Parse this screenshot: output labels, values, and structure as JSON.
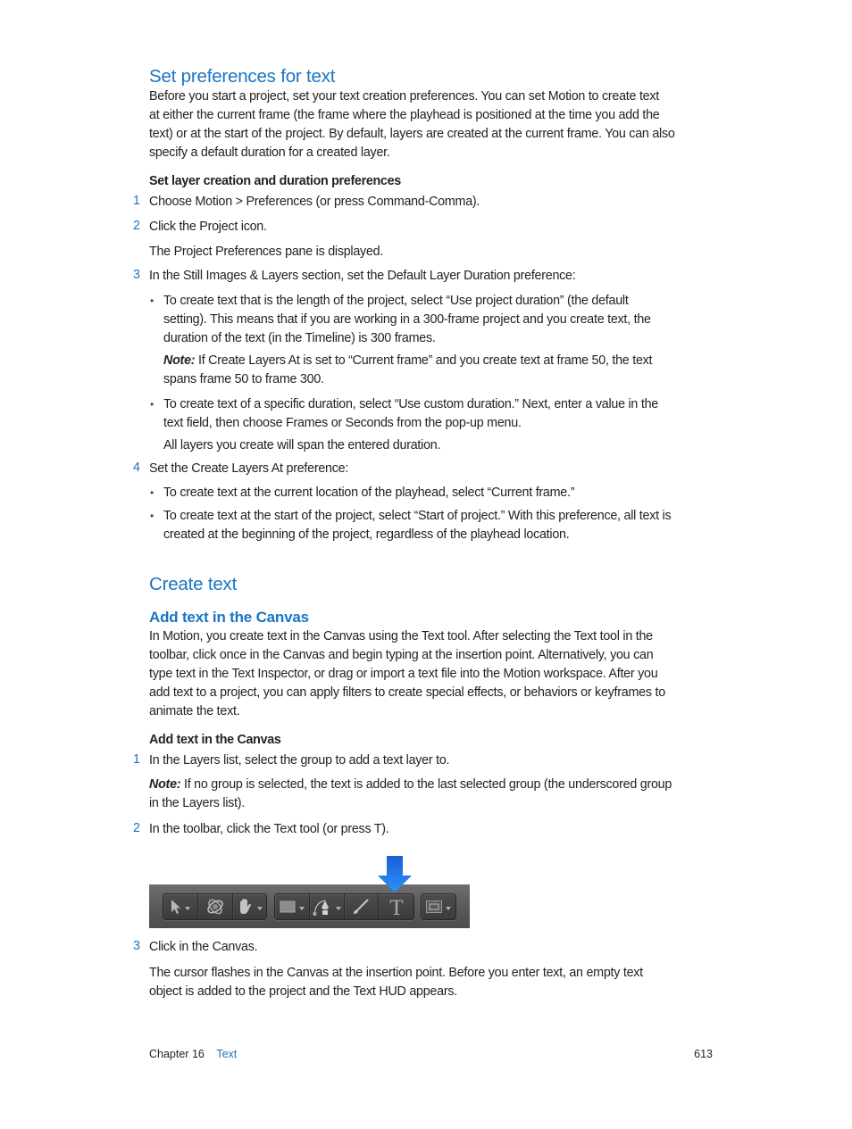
{
  "section1": {
    "heading": "Set preferences for text",
    "intro_lines": [
      "Before you start a project, set your text creation preferences. You can set Motion to create text",
      "at either the current frame (the frame where the playhead is positioned at the time you add the",
      "text) or at the start of the project. By default, layers are created at the current frame. You can also",
      "specify a default duration for a created layer."
    ],
    "task_title": "Set layer creation and duration preferences",
    "steps": [
      {
        "num": "1",
        "text": "Choose Motion > Preferences (or press Command-Comma)."
      },
      {
        "num": "2",
        "text": "Click the Project icon.",
        "result": "The Project Preferences pane is displayed."
      },
      {
        "num": "3",
        "text": "In the Still Images & Layers section, set the Default Layer Duration preference:",
        "bullets": [
          {
            "lines": [
              "To create text that is the length of the project, select “Use project duration” (the default",
              "setting). This means that if you are working in a 300-frame project and you create text, the",
              "duration of the text (in the Timeline) is 300 frames."
            ],
            "note_label": "Note:",
            "note_lines": [
              " If Create Layers At is set to “Current frame” and you create text at frame 50, the text",
              "spans frame 50 to frame 300."
            ]
          },
          {
            "lines": [
              "To create text of a specific duration, select “Use custom duration.” Next, enter a value in the",
              "text field, then choose Frames or Seconds from the pop-up menu."
            ],
            "result": "All layers you create will span the entered duration."
          }
        ]
      },
      {
        "num": "4",
        "text": "Set the Create Layers At preference:",
        "bullets": [
          {
            "lines": [
              "To create text at the current location of the playhead, select “Current frame.”"
            ]
          },
          {
            "lines": [
              "To create text at the start of the project, select “Start of project.” With this preference, all text is",
              "created at the beginning of the project, regardless of the playhead location."
            ]
          }
        ]
      }
    ]
  },
  "section2": {
    "heading": "Create text",
    "subheading": "Add text in the Canvas",
    "intro_lines": [
      "In Motion, you create text in the Canvas using the Text tool. After selecting the Text tool in the",
      "toolbar, click once in the Canvas and begin typing at the insertion point. Alternatively, you can",
      "type text in the Text Inspector, or drag or import a text file into the Motion workspace. After you",
      "add text to a project, you can apply filters to create special effects, or behaviors or keyframes to",
      "animate the text."
    ],
    "task_title": "Add text in the Canvas",
    "steps": [
      {
        "num": "1",
        "text": "In the Layers list, select the group to add a text layer to.",
        "note_label": "Note:",
        "note_lines": [
          " If no group is selected, the text is added to the last selected group (the underscored group",
          "in the Layers list)."
        ]
      },
      {
        "num": "2",
        "text": "In the toolbar, click the Text tool (or press T)."
      },
      {
        "num": "3",
        "text": "Click in the Canvas.",
        "result_lines": [
          "The cursor flashes in the Canvas at the insertion point. Before you enter text, an empty text",
          "object is added to the project and the Text HUD appears."
        ]
      }
    ]
  },
  "toolbar_figure": {
    "groups": [
      {
        "tools": [
          {
            "icon": "select-arrow-icon",
            "has_menu": true
          },
          {
            "icon": "3d-transform-icon",
            "has_menu": false
          },
          {
            "icon": "pan-hand-icon",
            "has_menu": true
          }
        ]
      },
      {
        "tools": [
          {
            "icon": "rectangle-shape-icon",
            "has_menu": true
          },
          {
            "icon": "bezier-pen-icon",
            "has_menu": true
          },
          {
            "icon": "paint-brush-icon",
            "has_menu": false
          },
          {
            "icon": "text-tool-icon",
            "label": "T",
            "has_menu": false,
            "highlighted": true
          }
        ]
      },
      {
        "tools": [
          {
            "icon": "mask-rectangle-icon",
            "has_menu": true
          }
        ]
      }
    ],
    "callout_color": "#1f7cf0"
  },
  "footer": {
    "chapter": "Chapter 16",
    "chapter_title": "Text",
    "page_number": "613"
  },
  "colors": {
    "heading_blue": "#1a74c4",
    "body_text": "#222222"
  }
}
